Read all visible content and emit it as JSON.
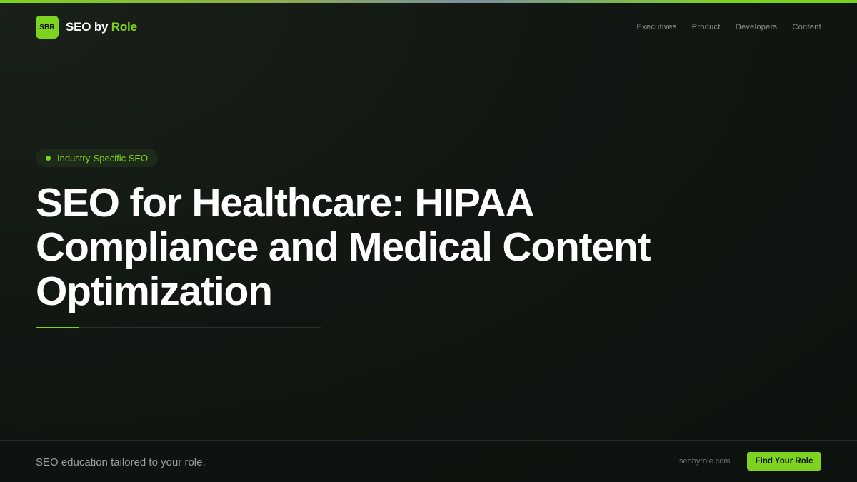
{
  "colors": {
    "accent": "#7ed321",
    "background": "#121712",
    "text": "#ffffff",
    "muted": "#8b918b"
  },
  "brand": {
    "logo_text": "SBR",
    "name_prefix": "SEO by",
    "name_accent": "Role"
  },
  "nav": {
    "items": [
      "Executives",
      "Product",
      "Developers",
      "Content"
    ]
  },
  "hero": {
    "badge_label": "Industry-Specific SEO",
    "title": "SEO for Healthcare: HIPAA Compliance and Medical Content Optimization"
  },
  "footer": {
    "tagline": "SEO education tailored to your role.",
    "domain": "seobyrole.com",
    "cta_label": "Find Your Role"
  }
}
